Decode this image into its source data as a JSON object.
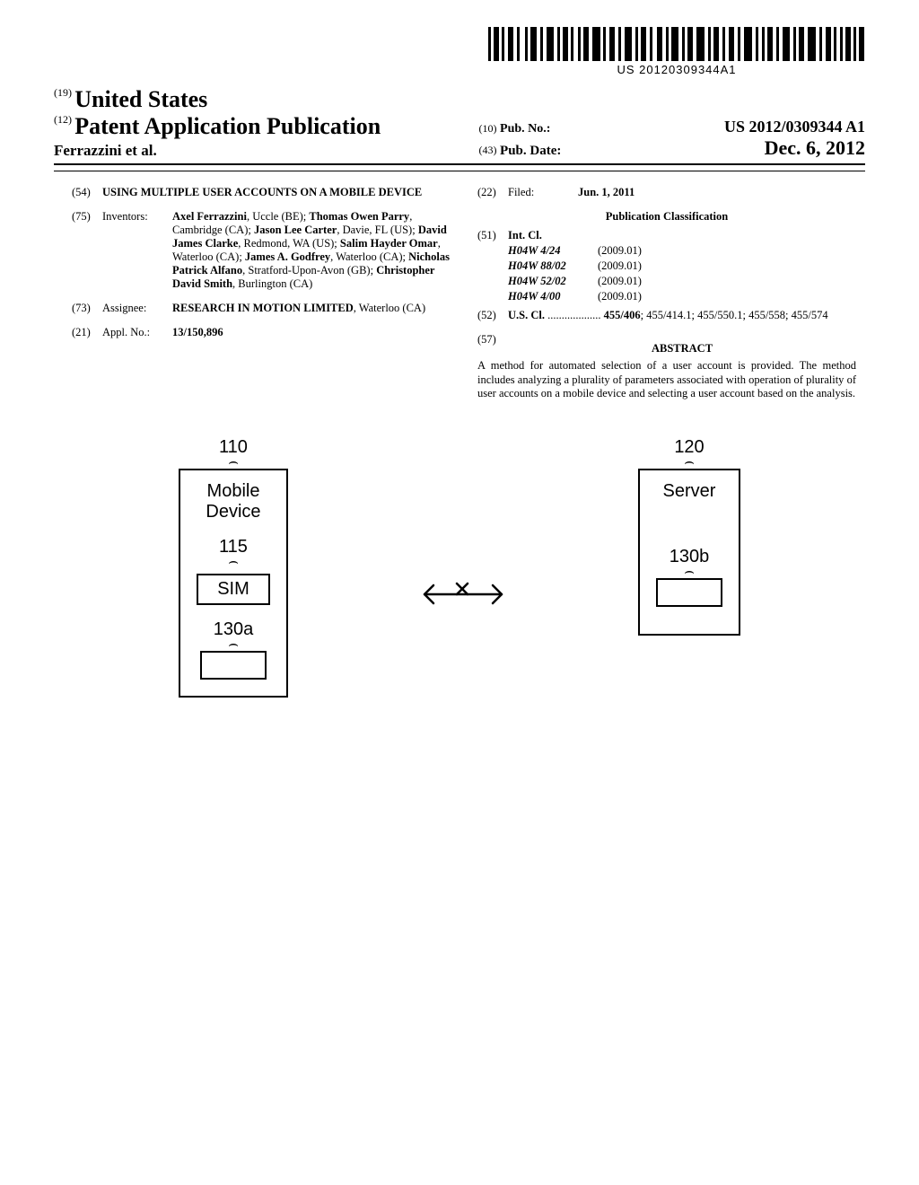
{
  "barcode_number": "US 20120309344A1",
  "header": {
    "prefix_19": "(19)",
    "country": "United States",
    "prefix_12": "(12)",
    "doc_type": "Patent Application Publication",
    "authors_line": "Ferrazzini et al.",
    "prefix_10": "(10)",
    "pub_no_label": "Pub. No.:",
    "pub_no": "US 2012/0309344 A1",
    "prefix_43": "(43)",
    "pub_date_label": "Pub. Date:",
    "pub_date": "Dec. 6, 2012"
  },
  "left": {
    "f54_num": "(54)",
    "f54_title": "USING MULTIPLE USER ACCOUNTS ON A MOBILE DEVICE",
    "f75_num": "(75)",
    "f75_label": "Inventors:",
    "inventors": [
      {
        "name": "Axel Ferrazzini",
        "loc": ", Uccle (BE); "
      },
      {
        "name": "Thomas Owen Parry",
        "loc": ", Cambridge (CA); "
      },
      {
        "name": "Jason Lee Carter",
        "loc": ", Davie, FL (US); "
      },
      {
        "name": "David James Clarke",
        "loc": ", Redmond, WA (US); "
      },
      {
        "name": "Salim Hayder Omar",
        "loc": ", Waterloo (CA); "
      },
      {
        "name": "James A. Godfrey",
        "loc": ", Waterloo (CA); "
      },
      {
        "name": "Nicholas Patrick Alfano",
        "loc": ", Stratford-Upon-Avon (GB); "
      },
      {
        "name": "Christopher David Smith",
        "loc": ", Burlington (CA)"
      }
    ],
    "f73_num": "(73)",
    "f73_label": "Assignee:",
    "f73_value_name": "RESEARCH IN MOTION LIMITED",
    "f73_value_loc": ", Waterloo (CA)",
    "f21_num": "(21)",
    "f21_label": "Appl. No.:",
    "f21_value": "13/150,896"
  },
  "right": {
    "f22_num": "(22)",
    "f22_label": "Filed:",
    "f22_value": "Jun. 1, 2011",
    "class_heading": "Publication Classification",
    "f51_num": "(51)",
    "f51_label": "Int. Cl.",
    "int_cl": [
      {
        "code": "H04W 4/24",
        "year": "(2009.01)"
      },
      {
        "code": "H04W 88/02",
        "year": "(2009.01)"
      },
      {
        "code": "H04W 52/02",
        "year": "(2009.01)"
      },
      {
        "code": "H04W 4/00",
        "year": "(2009.01)"
      }
    ],
    "f52_num": "(52)",
    "f52_label": "U.S. Cl.",
    "f52_dots": " ................... ",
    "f52_main": "455/406",
    "f52_rest": "; 455/414.1; 455/550.1; 455/558; 455/574",
    "f57_num": "(57)",
    "f57_heading": "ABSTRACT",
    "abstract": "A method for automated selection of a user account is provided. The method includes analyzing a plurality of parameters associated with operation of plurality of user accounts on a mobile device and selecting a user account based on the analysis."
  },
  "figure": {
    "ref_110": "110",
    "mobile_device": "Mobile",
    "mobile_device2": "Device",
    "ref_115": "115",
    "sim": "SIM",
    "ref_130a": "130a",
    "ref_120": "120",
    "server": "Server",
    "ref_130b": "130b"
  }
}
